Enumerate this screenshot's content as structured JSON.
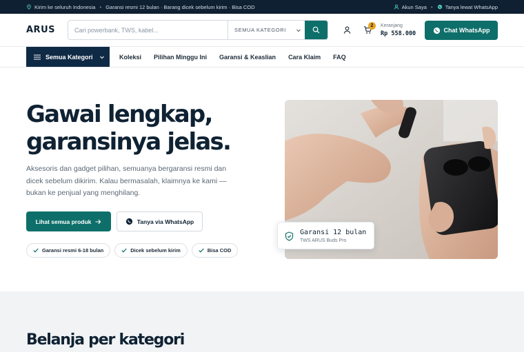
{
  "topbar": {
    "items_left": [
      "Kirim ke seluruh Indonesia",
      "Garansi resmi 12 bulan · Barang dicek sebelum kirim · Bisa COD"
    ],
    "account": "Akun Saya",
    "whatsapp": "Tanya lewat WhatsApp"
  },
  "header": {
    "logo": "ARUS",
    "search_placeholder": "Cari powerbank, TWS, kabel...",
    "search_category": "SEMUA KATEGORI",
    "cart_count": "2",
    "cart_label": "Keranjang",
    "cart_total": "Rp 558.000",
    "whatsapp_button": "Chat WhatsApp"
  },
  "nav": {
    "all_categories": "Semua Kategori",
    "links": [
      "Koleksi",
      "Pilihan Minggu Ini",
      "Garansi & Keaslian",
      "Cara Klaim",
      "FAQ"
    ]
  },
  "hero": {
    "title_line1": "Gawai lengkap,",
    "title_line2": "garansinya jelas.",
    "subtitle": "Aksesoris dan gadget pilihan, semuanya bergaransi resmi dan dicek sebelum dikirim. Kalau bermasalah, klaimnya ke kami — bukan ke penjual yang menghilang.",
    "primary_button": "Lihat semua produk",
    "secondary_button": "Tanya via WhatsApp",
    "chips": [
      "Garansi resmi 6-18 bulan",
      "Dicek sebelum kirim",
      "Bisa COD"
    ],
    "warranty_title": "Garansi 12 bulan",
    "warranty_product": "TWS ARUS Buds Pro"
  },
  "categories": {
    "title": "Belanja per kategori"
  },
  "colors": {
    "primary": "#0e6f6a",
    "navy": "#0f2032",
    "nav_dark": "#0f2a45",
    "badge": "#e5a424"
  }
}
